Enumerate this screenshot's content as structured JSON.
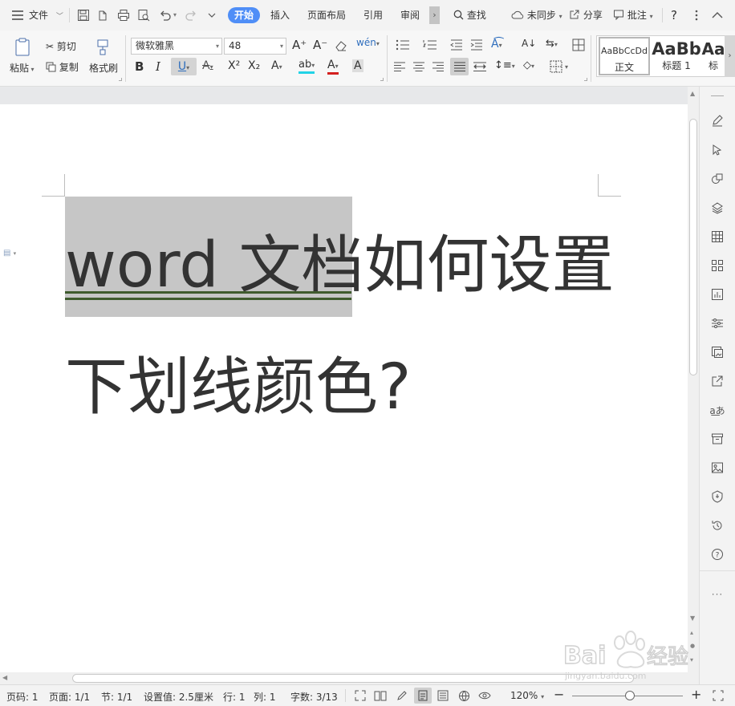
{
  "menubar": {
    "file_label": "文件",
    "tabs": [
      {
        "label": "开始",
        "active": true
      },
      {
        "label": "插入",
        "active": false
      },
      {
        "label": "页面布局",
        "active": false
      },
      {
        "label": "引用",
        "active": false
      },
      {
        "label": "审阅",
        "active": false
      }
    ],
    "more_tabs": "›",
    "search_label": "查找",
    "sync_label": "未同步",
    "share_label": "分享",
    "comment_label": "批注",
    "help_label": "?",
    "accent_color": "#4f8ef7"
  },
  "ribbon": {
    "paste_label": "粘贴",
    "cut_label": "剪切",
    "copy_label": "复制",
    "format_painter_label": "格式刷",
    "font_name": "微软雅黑",
    "font_size": "48",
    "styles": [
      {
        "preview": "AaBbCcDd",
        "name": "正文"
      },
      {
        "preview": "AaBb",
        "name": "标题 1"
      },
      {
        "preview": "Aa",
        "name": "标"
      }
    ]
  },
  "document": {
    "line1_selected": "word 文档",
    "line1_rest": "如何设置",
    "line2": "下划线颜色?",
    "underline_color": "#3f5b2e",
    "selection_color": "#c6c6c6"
  },
  "statusbar": {
    "page_num": "页码: 1",
    "pages": "页面: 1/1",
    "section": "节: 1/1",
    "setting": "设置值: 2.5厘米",
    "row": "行: 1",
    "col": "列: 1",
    "word_count": "字数: 3/13",
    "zoom": "120%",
    "zoom_level": 0.52
  }
}
